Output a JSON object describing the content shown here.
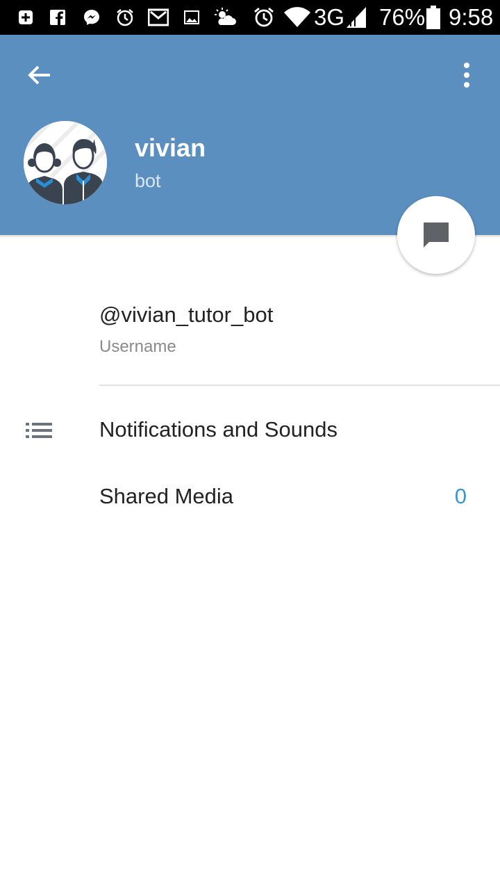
{
  "status_bar": {
    "network": "3G",
    "battery": "76%",
    "time": "9:58",
    "icons": [
      "add-icon",
      "facebook-icon",
      "messenger-icon",
      "alarm-icon",
      "gmail-icon",
      "gallery-icon",
      "weather-icon",
      "alarm-clock-icon",
      "wifi-icon",
      "signal-icon",
      "battery-icon"
    ]
  },
  "header": {
    "name": "vivian",
    "status": "bot",
    "background_color": "#5b8fbf"
  },
  "info": {
    "username_value": "@vivian_tutor_bot",
    "username_label": "Username"
  },
  "menu": {
    "notifications_label": "Notifications and Sounds",
    "shared_media_label": "Shared Media",
    "shared_media_count": "0"
  },
  "colors": {
    "accent": "#3a95d5",
    "header": "#5b8fbf"
  }
}
